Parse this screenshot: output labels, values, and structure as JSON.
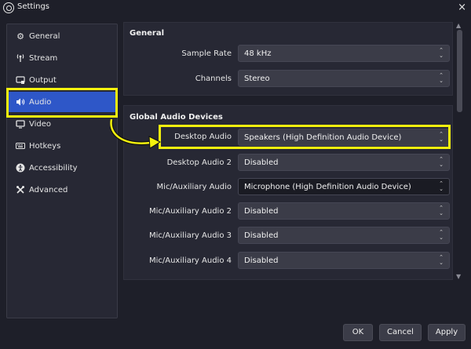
{
  "window": {
    "title": "Settings",
    "close_label": "×"
  },
  "sidebar": {
    "items": [
      {
        "label": "General",
        "icon": "gear-icon",
        "glyph": "⚙"
      },
      {
        "label": "Stream",
        "icon": "antenna-icon",
        "glyph": "📡"
      },
      {
        "label": "Output",
        "icon": "monitor-icon",
        "glyph": "▭"
      },
      {
        "label": "Audio",
        "icon": "speaker-icon",
        "glyph": "🔊"
      },
      {
        "label": "Video",
        "icon": "screen-icon",
        "glyph": "▭"
      },
      {
        "label": "Hotkeys",
        "icon": "keyboard-icon",
        "glyph": "⌨"
      },
      {
        "label": "Accessibility",
        "icon": "accessibility-icon",
        "glyph": "♿"
      },
      {
        "label": "Advanced",
        "icon": "wrench-icon",
        "glyph": "✂"
      }
    ],
    "active": "Audio"
  },
  "general": {
    "title": "General",
    "sample_rate_label": "Sample Rate",
    "sample_rate_value": "48 kHz",
    "channels_label": "Channels",
    "channels_value": "Stereo"
  },
  "global_audio": {
    "title": "Global Audio Devices",
    "rows": [
      {
        "label": "Desktop Audio",
        "value": "Speakers (High Definition Audio Device)"
      },
      {
        "label": "Desktop Audio 2",
        "value": "Disabled"
      },
      {
        "label": "Mic/Auxiliary Audio",
        "value": "Microphone (High Definition Audio Device)"
      },
      {
        "label": "Mic/Auxiliary Audio 2",
        "value": "Disabled"
      },
      {
        "label": "Mic/Auxiliary Audio 3",
        "value": "Disabled"
      },
      {
        "label": "Mic/Auxiliary Audio 4",
        "value": "Disabled"
      }
    ]
  },
  "buttons": {
    "ok": "OK",
    "cancel": "Cancel",
    "apply": "Apply"
  },
  "colors": {
    "highlight": "#f4f20e",
    "accent": "#2e57c8",
    "background": "#1e1f29"
  }
}
